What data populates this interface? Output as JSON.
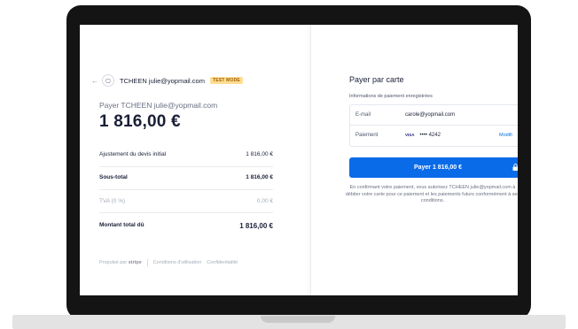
{
  "merchant": {
    "logo_glyph": "▢",
    "name": "TCHEEN julie@yopmail.com",
    "test_badge": "TEST MODE"
  },
  "summary": {
    "pay_label": "Payer TCHEEN julie@yopmail.com",
    "amount": "1 816,00 €",
    "lines": [
      {
        "label": "Ajustement du devis initial",
        "value": "1 816,00 €"
      },
      {
        "label": "Sous-total",
        "value": "1 816,00 €"
      },
      {
        "label": "TVA (0 %)",
        "value": "0,00 €"
      },
      {
        "label": "Montant total dû",
        "value": "1 816,00 €"
      }
    ]
  },
  "footer": {
    "powered_by": "Propulsé par",
    "brand": "stripe",
    "terms": "Conditions d'utilisation",
    "privacy": "Confidentialité"
  },
  "payment": {
    "title": "Payer par carte",
    "saved_label": "Informations de paiement enregistrées",
    "email_key": "E-mail",
    "email_value": "carole@yopmail.com",
    "payment_key": "Paiement",
    "card_brand": "VISA",
    "card_masked": "•••• 4242",
    "modify_label": "Modifi",
    "button_label": "Payer 1 816,00 €",
    "consent_text": "En confirmant votre paiement, vous autorisez TCHEEN julie@yopmail.com à débiter votre carte pour ce paiement et les paiements futurs conformément à ses conditions."
  },
  "colors": {
    "accent": "#0a6be8",
    "badge_bg": "#ffde92",
    "badge_text": "#9e5c00"
  }
}
